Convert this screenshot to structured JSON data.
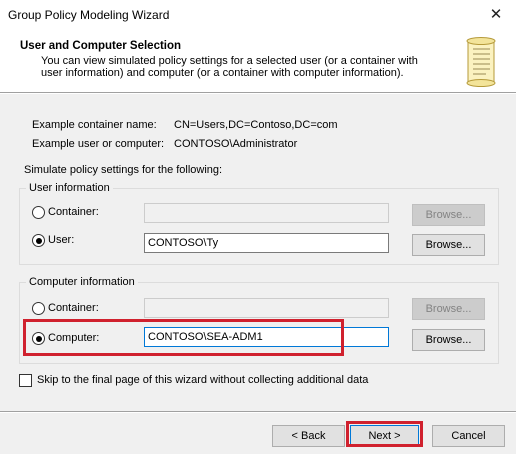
{
  "window": {
    "title": "Group Policy Modeling Wizard",
    "close_glyph": "✕"
  },
  "header": {
    "title": "User and Computer Selection",
    "description": "You can view simulated policy settings for a selected user (or a container with user information) and computer (or a container with computer information).",
    "icon": "scroll-icon"
  },
  "examples": {
    "container_label": "Example container name:",
    "container_value": "CN=Users,DC=Contoso,DC=com",
    "user_label": "Example user or computer:",
    "user_value": "CONTOSO\\Administrator"
  },
  "simulate_label": "Simulate policy settings for the following:",
  "user_info": {
    "legend": "User information",
    "container_label": "Container:",
    "container_value": "",
    "user_label": "User:",
    "user_value": "CONTOSO\\Ty",
    "selected": "user",
    "browse_container": "Browse...",
    "browse_user": "Browse..."
  },
  "computer_info": {
    "legend": "Computer information",
    "container_label": "Container:",
    "container_value": "",
    "computer_label": "Computer:",
    "computer_value": "CONTOSO\\SEA-ADM1",
    "selected": "computer",
    "browse_container": "Browse...",
    "browse_computer": "Browse..."
  },
  "skip_checkbox": {
    "label": "Skip to the final page of this wizard without collecting additional data",
    "checked": false
  },
  "footer": {
    "back": "< Back",
    "next": "Next >",
    "cancel": "Cancel"
  },
  "colors": {
    "highlight": "#d0212e",
    "focus": "#0078d7"
  }
}
